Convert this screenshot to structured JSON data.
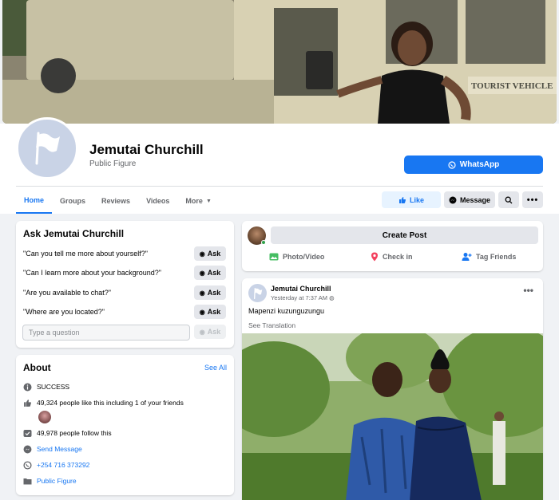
{
  "profile": {
    "name": "Jemutai Churchill",
    "category": "Public Figure",
    "whatsapp_label": "WhatsApp"
  },
  "tabs": [
    "Home",
    "Groups",
    "Reviews",
    "Videos",
    "More"
  ],
  "actions": {
    "like": "Like",
    "message": "Message"
  },
  "ask": {
    "title": "Ask Jemutai Churchill",
    "questions": [
      "\"Can you tell me more about yourself?\"",
      "\"Can I learn more about your background?\"",
      "\"Are you available to chat?\"",
      "\"Where are you located?\""
    ],
    "ask_label": "Ask",
    "placeholder": "Type a question"
  },
  "about": {
    "title": "About",
    "see_all": "See All",
    "status": "SUCCESS",
    "likes": "49,324 people like this including 1 of your friends",
    "follows": "49,978 people follow this",
    "send_message": "Send Message",
    "phone": "+254 716 373292",
    "category": "Public Figure"
  },
  "create_post": {
    "button": "Create Post",
    "photo_video": "Photo/Video",
    "check_in": "Check in",
    "tag_friends": "Tag Friends"
  },
  "post": {
    "author": "Jemutai Churchill",
    "time": "Yesterday at 7:37 AM",
    "text": "Mapenzi kuzunguzungu",
    "see_translation": "See Translation"
  },
  "colors": {
    "accent": "#1877f2",
    "background": "#f0f2f5"
  }
}
